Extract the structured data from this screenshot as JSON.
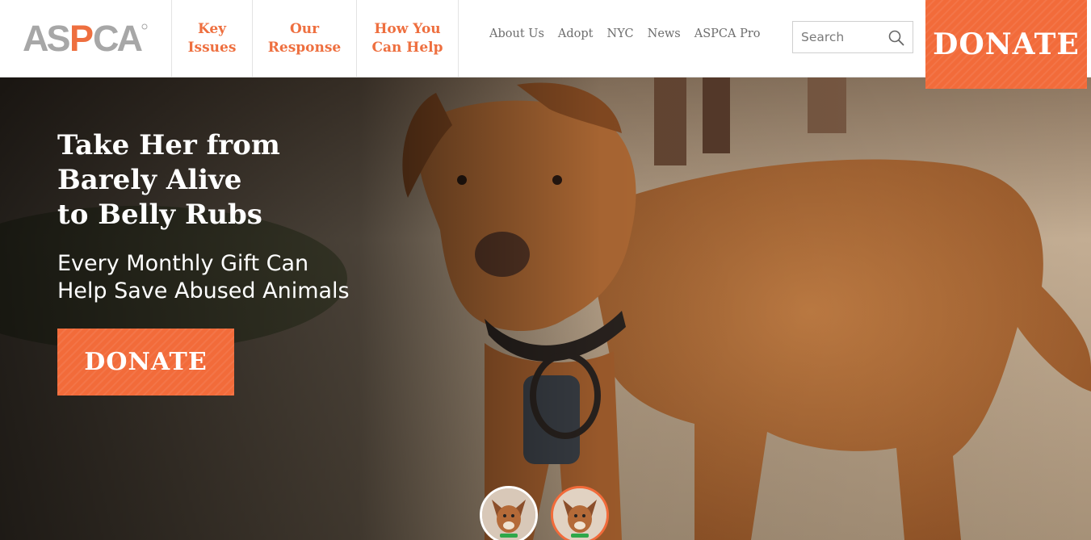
{
  "brand": {
    "logo_text": "ASPCA",
    "colors": {
      "accent": "#f26b3a",
      "logo_gray": "#a5a5a5",
      "nav_orange": "#ee6f3f"
    }
  },
  "main_nav": [
    {
      "label": "Key\nIssues"
    },
    {
      "label": "Our\nResponse"
    },
    {
      "label": "How You\nCan Help"
    }
  ],
  "util_nav": [
    "About Us",
    "Adopt",
    "NYC",
    "News",
    "ASPCA Pro"
  ],
  "search": {
    "placeholder": "Search",
    "icon": "search-icon"
  },
  "header_donate": "DONATE",
  "hero": {
    "title": "Take Her from\nBarely Alive\nto Belly Rubs",
    "subtitle": "Every Monthly Gift Can\nHelp Save Abused Animals",
    "donate_label": "DONATE"
  }
}
